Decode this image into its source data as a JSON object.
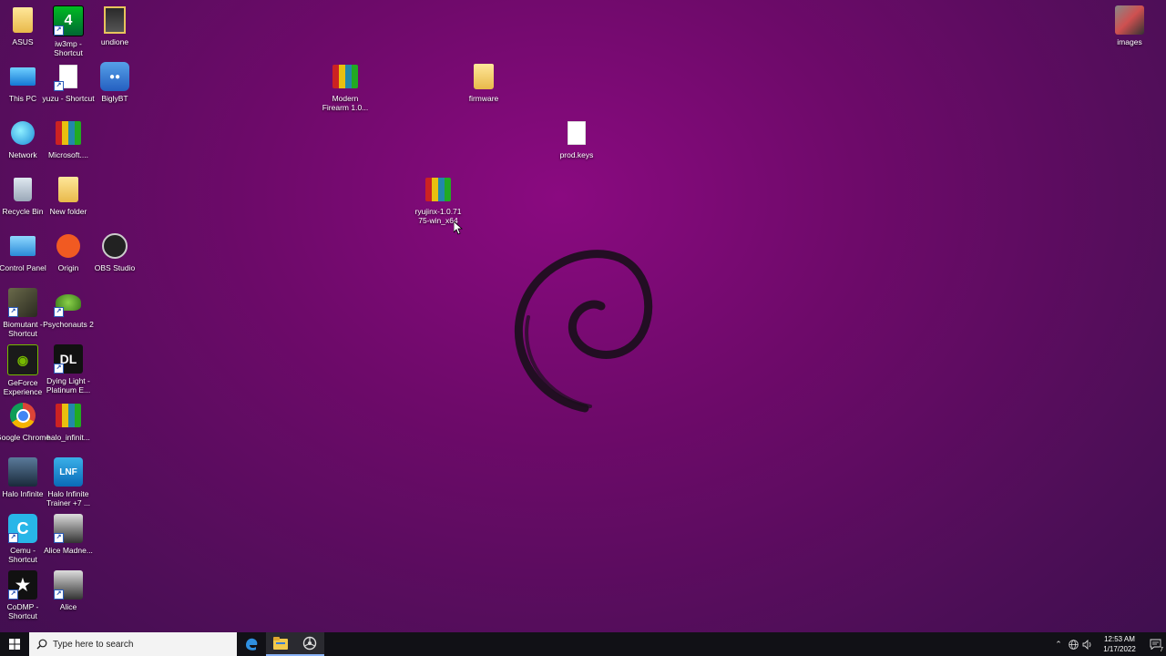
{
  "desktop": {
    "icons": {
      "asus": {
        "label": "ASUS"
      },
      "iw3mp": {
        "label": "iw3mp - Shortcut"
      },
      "undione": {
        "label": "undione"
      },
      "this_pc": {
        "label": "This PC"
      },
      "yuzu": {
        "label": "yuzu - Shortcut"
      },
      "biglybt": {
        "label": "BiglyBT"
      },
      "network": {
        "label": "Network"
      },
      "microsoft": {
        "label": "Microsoft...."
      },
      "recycle_bin": {
        "label": "Recycle Bin"
      },
      "new_folder": {
        "label": "New folder"
      },
      "control_panel": {
        "label": "Control Panel"
      },
      "origin": {
        "label": "Origin"
      },
      "obs": {
        "label": "OBS Studio"
      },
      "biomutant": {
        "label": "Biomutant - Shortcut"
      },
      "psychonauts": {
        "label": "Psychonauts 2"
      },
      "geforce": {
        "label": "GeForce Experience"
      },
      "dying_light": {
        "label": "Dying Light - Platinum E..."
      },
      "chrome": {
        "label": "Google Chrome"
      },
      "halo_zip": {
        "label": "halo_infinit..."
      },
      "halo_infinite": {
        "label": "Halo Infinite"
      },
      "halo_trainer": {
        "label": "Halo Infinite Trainer +7 ..."
      },
      "cemu": {
        "label": "Cemu - Shortcut"
      },
      "alice_madness": {
        "label": "Alice Madne..."
      },
      "codmp": {
        "label": "CoDMP - Shortcut"
      },
      "alice": {
        "label": "Alice"
      },
      "modern_firearm": {
        "label": "Modern Firearm 1.0..."
      },
      "firmware": {
        "label": "firmware"
      },
      "prod_keys": {
        "label": "prod.keys"
      },
      "ryujinx": {
        "label": "ryujinx-1.0.71 75-win_x64"
      },
      "images": {
        "label": "images"
      }
    },
    "icon_glyphs": {
      "iw3mp": "4",
      "lnf": "LNF",
      "cemu": "C",
      "dl": "DL",
      "codmp": "★"
    }
  },
  "taskbar": {
    "search_placeholder": "Type here to search",
    "pinned": [
      "edge-icon",
      "file-explorer-icon",
      "app-icon"
    ],
    "clock": {
      "time": "12:53 AM",
      "date": "1/17/2022"
    },
    "notifications_count": "7"
  },
  "colors": {
    "wallpaper": "#7a0a74",
    "taskbar": "#111116",
    "accent": "#8ab4f8"
  }
}
